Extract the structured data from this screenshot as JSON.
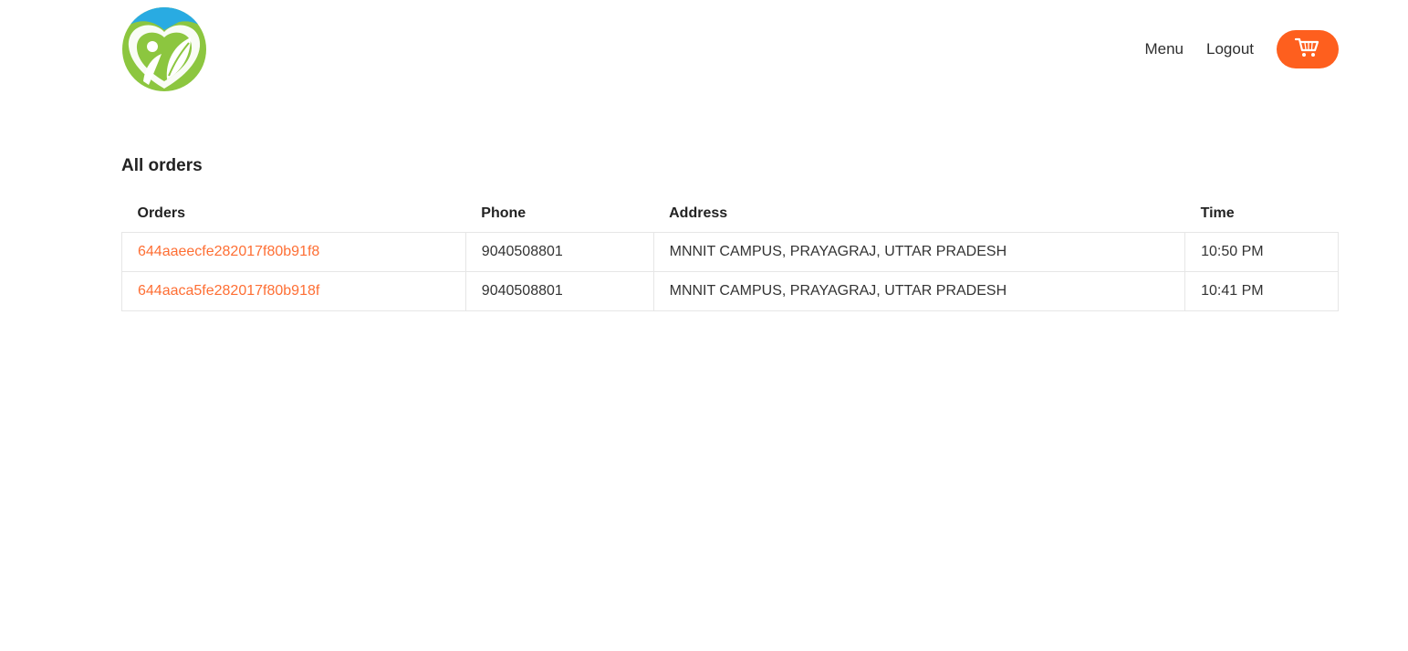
{
  "nav": {
    "menu_label": "Menu",
    "logout_label": "Logout"
  },
  "icons": {
    "logo": "leaf-heart-logo",
    "cart": "cart-icon"
  },
  "colors": {
    "accent": "#fe5f1e",
    "logo_green": "#8cc63f",
    "logo_blue": "#29abe2"
  },
  "main": {
    "title": "All orders",
    "table": {
      "headers": [
        "Orders",
        "Phone",
        "Address",
        "Time"
      ],
      "rows": [
        {
          "order_id": "644aaeecfe282017f80b91f8",
          "phone": "9040508801",
          "address": "MNNIT CAMPUS, PRAYAGRAJ, UTTAR PRADESH",
          "time": "10:50 PM"
        },
        {
          "order_id": "644aaca5fe282017f80b918f",
          "phone": "9040508801",
          "address": "MNNIT CAMPUS, PRAYAGRAJ, UTTAR PRADESH",
          "time": "10:41 PM"
        }
      ]
    }
  }
}
